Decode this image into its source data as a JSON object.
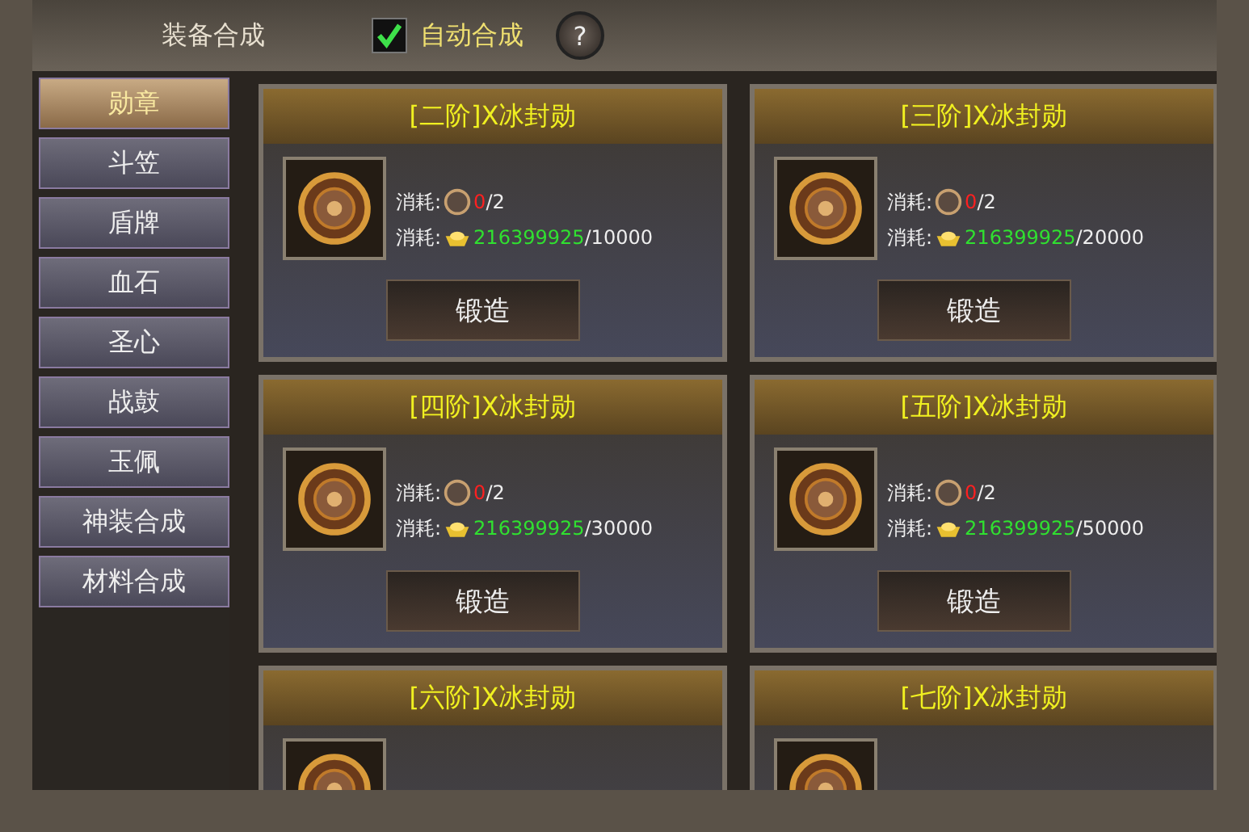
{
  "header": {
    "title": "装备合成",
    "auto": {
      "label": "自动合成",
      "checked": true
    },
    "help": "?"
  },
  "sidebar": [
    {
      "label": "勋章",
      "selected": true
    },
    {
      "label": "斗笠",
      "selected": false
    },
    {
      "label": "盾牌",
      "selected": false
    },
    {
      "label": "血石",
      "selected": false
    },
    {
      "label": "圣心",
      "selected": false
    },
    {
      "label": "战鼓",
      "selected": false
    },
    {
      "label": "玉佩",
      "selected": false
    },
    {
      "label": "神装合成",
      "selected": false
    },
    {
      "label": "材料合成",
      "selected": false
    }
  ],
  "cards": [
    {
      "title": "[二阶]X冰封勋",
      "costs": [
        {
          "kind": "item",
          "label": "消耗:",
          "have": "0",
          "need": "/2",
          "enough": false
        },
        {
          "kind": "gold",
          "label": "消耗:",
          "have": "216399925",
          "need": "/10000",
          "enough": true
        }
      ],
      "button": "锻造"
    },
    {
      "title": "[三阶]X冰封勋",
      "costs": [
        {
          "kind": "item",
          "label": "消耗:",
          "have": "0",
          "need": "/2",
          "enough": false
        },
        {
          "kind": "gold",
          "label": "消耗:",
          "have": "216399925",
          "need": "/20000",
          "enough": true
        }
      ],
      "button": "锻造"
    },
    {
      "title": "[四阶]X冰封勋",
      "costs": [
        {
          "kind": "item",
          "label": "消耗:",
          "have": "0",
          "need": "/2",
          "enough": false
        },
        {
          "kind": "gold",
          "label": "消耗:",
          "have": "216399925",
          "need": "/30000",
          "enough": true
        }
      ],
      "button": "锻造"
    },
    {
      "title": "[五阶]X冰封勋",
      "costs": [
        {
          "kind": "item",
          "label": "消耗:",
          "have": "0",
          "need": "/2",
          "enough": false
        },
        {
          "kind": "gold",
          "label": "消耗:",
          "have": "216399925",
          "need": "/50000",
          "enough": true
        }
      ],
      "button": "锻造"
    },
    {
      "title": "[六阶]X冰封勋"
    },
    {
      "title": "[七阶]X冰封勋"
    }
  ]
}
